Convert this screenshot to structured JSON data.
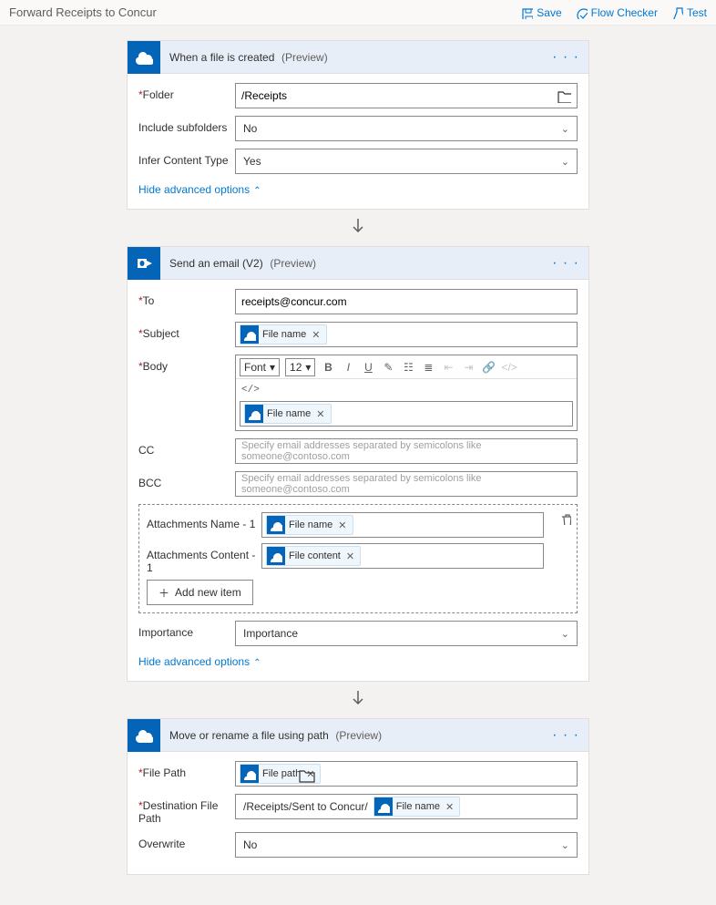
{
  "topbar": {
    "title": "Forward Receipts to Concur",
    "save": "Save",
    "checker": "Flow Checker",
    "test": "Test"
  },
  "card1": {
    "title": "When a file is created",
    "preview": "(Preview)",
    "folder_label": "Folder",
    "folder_value": "/Receipts",
    "subfolders_label": "Include subfolders",
    "subfolders_value": "No",
    "infer_label": "Infer Content Type",
    "infer_value": "Yes",
    "hide": "Hide advanced options"
  },
  "card2": {
    "title": "Send an email (V2)",
    "preview": "(Preview)",
    "to_label": "To",
    "to_value": "receipts@concur.com",
    "subject_label": "Subject",
    "body_label": "Body",
    "cc_label": "CC",
    "bcc_label": "BCC",
    "addr_ph": "Specify email addresses separated by semicolons like someone@contoso.com",
    "att_name_label": "Attachments Name - 1",
    "att_content_label": "Attachments Content - 1",
    "add_item": "Add new item",
    "importance_label": "Importance",
    "importance_value": "Importance",
    "hide": "Hide advanced options",
    "font_label": "Font",
    "font_size": "12",
    "token_filename": "File name",
    "token_filecontent": "File content",
    "code_tag": "</>"
  },
  "card3": {
    "title": "Move or rename a file using path",
    "preview": "(Preview)",
    "filepath_label": "File Path",
    "destpath_label": "Destination File Path",
    "destpath_prefix": "/Receipts/Sent to Concur/",
    "overwrite_label": "Overwrite",
    "overwrite_value": "No",
    "token_filepath": "File path",
    "token_filename": "File name"
  }
}
